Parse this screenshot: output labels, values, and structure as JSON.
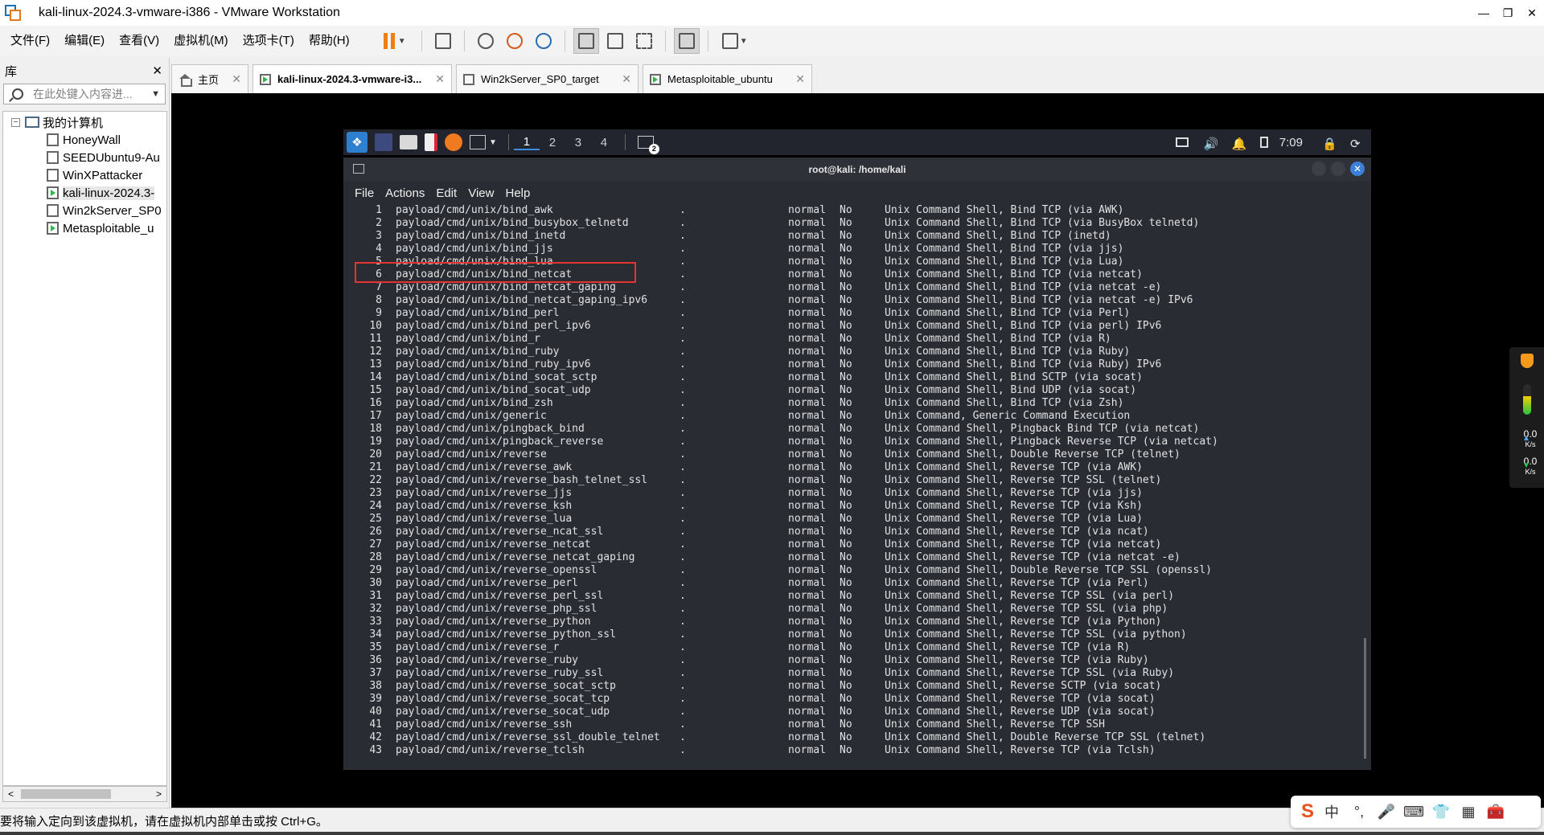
{
  "window": {
    "title": "kali-linux-2024.3-vmware-i386 - VMware Workstation"
  },
  "menu": [
    "文件(F)",
    "编辑(E)",
    "查看(V)",
    "虚拟机(M)",
    "选项卡(T)",
    "帮助(H)"
  ],
  "library": {
    "title": "库",
    "search_placeholder": "在此处键入内容进...",
    "root": "我的计算机",
    "items": [
      {
        "label": "HoneyWall",
        "running": false
      },
      {
        "label": "SEEDUbuntu9-Au",
        "running": false
      },
      {
        "label": "WinXPattacker",
        "running": false
      },
      {
        "label": "kali-linux-2024.3-",
        "running": true,
        "selected": true
      },
      {
        "label": "Win2kServer_SP0",
        "running": false
      },
      {
        "label": "Metasploitable_u",
        "running": true
      }
    ]
  },
  "tabs": [
    {
      "label": "主页",
      "active": false
    },
    {
      "label": "kali-linux-2024.3-vmware-i3...",
      "active": true
    },
    {
      "label": "Win2kServer_SP0_target",
      "active": false
    },
    {
      "label": "Metasploitable_ubuntu",
      "active": false
    }
  ],
  "kali_panel": {
    "workspaces": [
      "1",
      "2",
      "3",
      "4"
    ],
    "active_workspace": "1",
    "clock": "7:09",
    "terminal_badge": "2"
  },
  "terminal": {
    "title": "root@kali: /home/kali",
    "menu": [
      "File",
      "Actions",
      "Edit",
      "View",
      "Help"
    ],
    "rows": [
      {
        "num": "1",
        "name": "payload/cmd/unix/bind_awk",
        "date": ".",
        "rank": "normal",
        "check": "No",
        "desc": "Unix Command Shell, Bind TCP (via AWK)"
      },
      {
        "num": "2",
        "name": "payload/cmd/unix/bind_busybox_telnetd",
        "date": ".",
        "rank": "normal",
        "check": "No",
        "desc": "Unix Command Shell, Bind TCP (via BusyBox telnetd)"
      },
      {
        "num": "3",
        "name": "payload/cmd/unix/bind_inetd",
        "date": ".",
        "rank": "normal",
        "check": "No",
        "desc": "Unix Command Shell, Bind TCP (inetd)"
      },
      {
        "num": "4",
        "name": "payload/cmd/unix/bind_jjs",
        "date": ".",
        "rank": "normal",
        "check": "No",
        "desc": "Unix Command Shell, Bind TCP (via jjs)"
      },
      {
        "num": "5",
        "name": "payload/cmd/unix/bind_lua",
        "date": ".",
        "rank": "normal",
        "check": "No",
        "desc": "Unix Command Shell, Bind TCP (via Lua)"
      },
      {
        "num": "6",
        "name": "payload/cmd/unix/bind_netcat",
        "date": ".",
        "rank": "normal",
        "check": "No",
        "desc": "Unix Command Shell, Bind TCP (via netcat)"
      },
      {
        "num": "7",
        "name": "payload/cmd/unix/bind_netcat_gaping",
        "date": ".",
        "rank": "normal",
        "check": "No",
        "desc": "Unix Command Shell, Bind TCP (via netcat -e)"
      },
      {
        "num": "8",
        "name": "payload/cmd/unix/bind_netcat_gaping_ipv6",
        "date": ".",
        "rank": "normal",
        "check": "No",
        "desc": "Unix Command Shell, Bind TCP (via netcat -e) IPv6"
      },
      {
        "num": "9",
        "name": "payload/cmd/unix/bind_perl",
        "date": ".",
        "rank": "normal",
        "check": "No",
        "desc": "Unix Command Shell, Bind TCP (via Perl)"
      },
      {
        "num": "10",
        "name": "payload/cmd/unix/bind_perl_ipv6",
        "date": ".",
        "rank": "normal",
        "check": "No",
        "desc": "Unix Command Shell, Bind TCP (via perl) IPv6"
      },
      {
        "num": "11",
        "name": "payload/cmd/unix/bind_r",
        "date": ".",
        "rank": "normal",
        "check": "No",
        "desc": "Unix Command Shell, Bind TCP (via R)"
      },
      {
        "num": "12",
        "name": "payload/cmd/unix/bind_ruby",
        "date": ".",
        "rank": "normal",
        "check": "No",
        "desc": "Unix Command Shell, Bind TCP (via Ruby)"
      },
      {
        "num": "13",
        "name": "payload/cmd/unix/bind_ruby_ipv6",
        "date": ".",
        "rank": "normal",
        "check": "No",
        "desc": "Unix Command Shell, Bind TCP (via Ruby) IPv6"
      },
      {
        "num": "14",
        "name": "payload/cmd/unix/bind_socat_sctp",
        "date": ".",
        "rank": "normal",
        "check": "No",
        "desc": "Unix Command Shell, Bind SCTP (via socat)"
      },
      {
        "num": "15",
        "name": "payload/cmd/unix/bind_socat_udp",
        "date": ".",
        "rank": "normal",
        "check": "No",
        "desc": "Unix Command Shell, Bind UDP (via socat)"
      },
      {
        "num": "16",
        "name": "payload/cmd/unix/bind_zsh",
        "date": ".",
        "rank": "normal",
        "check": "No",
        "desc": "Unix Command Shell, Bind TCP (via Zsh)"
      },
      {
        "num": "17",
        "name": "payload/cmd/unix/generic",
        "date": ".",
        "rank": "normal",
        "check": "No",
        "desc": "Unix Command, Generic Command Execution"
      },
      {
        "num": "18",
        "name": "payload/cmd/unix/pingback_bind",
        "date": ".",
        "rank": "normal",
        "check": "No",
        "desc": "Unix Command Shell, Pingback Bind TCP (via netcat)"
      },
      {
        "num": "19",
        "name": "payload/cmd/unix/pingback_reverse",
        "date": ".",
        "rank": "normal",
        "check": "No",
        "desc": "Unix Command Shell, Pingback Reverse TCP (via netcat)"
      },
      {
        "num": "20",
        "name": "payload/cmd/unix/reverse",
        "date": ".",
        "rank": "normal",
        "check": "No",
        "desc": "Unix Command Shell, Double Reverse TCP (telnet)"
      },
      {
        "num": "21",
        "name": "payload/cmd/unix/reverse_awk",
        "date": ".",
        "rank": "normal",
        "check": "No",
        "desc": "Unix Command Shell, Reverse TCP (via AWK)"
      },
      {
        "num": "22",
        "name": "payload/cmd/unix/reverse_bash_telnet_ssl",
        "date": ".",
        "rank": "normal",
        "check": "No",
        "desc": "Unix Command Shell, Reverse TCP SSL (telnet)"
      },
      {
        "num": "23",
        "name": "payload/cmd/unix/reverse_jjs",
        "date": ".",
        "rank": "normal",
        "check": "No",
        "desc": "Unix Command Shell, Reverse TCP (via jjs)"
      },
      {
        "num": "24",
        "name": "payload/cmd/unix/reverse_ksh",
        "date": ".",
        "rank": "normal",
        "check": "No",
        "desc": "Unix Command Shell, Reverse TCP (via Ksh)"
      },
      {
        "num": "25",
        "name": "payload/cmd/unix/reverse_lua",
        "date": ".",
        "rank": "normal",
        "check": "No",
        "desc": "Unix Command Shell, Reverse TCP (via Lua)"
      },
      {
        "num": "26",
        "name": "payload/cmd/unix/reverse_ncat_ssl",
        "date": ".",
        "rank": "normal",
        "check": "No",
        "desc": "Unix Command Shell, Reverse TCP (via ncat)"
      },
      {
        "num": "27",
        "name": "payload/cmd/unix/reverse_netcat",
        "date": ".",
        "rank": "normal",
        "check": "No",
        "desc": "Unix Command Shell, Reverse TCP (via netcat)"
      },
      {
        "num": "28",
        "name": "payload/cmd/unix/reverse_netcat_gaping",
        "date": ".",
        "rank": "normal",
        "check": "No",
        "desc": "Unix Command Shell, Reverse TCP (via netcat -e)"
      },
      {
        "num": "29",
        "name": "payload/cmd/unix/reverse_openssl",
        "date": ".",
        "rank": "normal",
        "check": "No",
        "desc": "Unix Command Shell, Double Reverse TCP SSL (openssl)"
      },
      {
        "num": "30",
        "name": "payload/cmd/unix/reverse_perl",
        "date": ".",
        "rank": "normal",
        "check": "No",
        "desc": "Unix Command Shell, Reverse TCP (via Perl)"
      },
      {
        "num": "31",
        "name": "payload/cmd/unix/reverse_perl_ssl",
        "date": ".",
        "rank": "normal",
        "check": "No",
        "desc": "Unix Command Shell, Reverse TCP SSL (via perl)"
      },
      {
        "num": "32",
        "name": "payload/cmd/unix/reverse_php_ssl",
        "date": ".",
        "rank": "normal",
        "check": "No",
        "desc": "Unix Command Shell, Reverse TCP SSL (via php)"
      },
      {
        "num": "33",
        "name": "payload/cmd/unix/reverse_python",
        "date": ".",
        "rank": "normal",
        "check": "No",
        "desc": "Unix Command Shell, Reverse TCP (via Python)"
      },
      {
        "num": "34",
        "name": "payload/cmd/unix/reverse_python_ssl",
        "date": ".",
        "rank": "normal",
        "check": "No",
        "desc": "Unix Command Shell, Reverse TCP SSL (via python)"
      },
      {
        "num": "35",
        "name": "payload/cmd/unix/reverse_r",
        "date": ".",
        "rank": "normal",
        "check": "No",
        "desc": "Unix Command Shell, Reverse TCP (via R)"
      },
      {
        "num": "36",
        "name": "payload/cmd/unix/reverse_ruby",
        "date": ".",
        "rank": "normal",
        "check": "No",
        "desc": "Unix Command Shell, Reverse TCP (via Ruby)"
      },
      {
        "num": "37",
        "name": "payload/cmd/unix/reverse_ruby_ssl",
        "date": ".",
        "rank": "normal",
        "check": "No",
        "desc": "Unix Command Shell, Reverse TCP SSL (via Ruby)"
      },
      {
        "num": "38",
        "name": "payload/cmd/unix/reverse_socat_sctp",
        "date": ".",
        "rank": "normal",
        "check": "No",
        "desc": "Unix Command Shell, Reverse SCTP (via socat)"
      },
      {
        "num": "39",
        "name": "payload/cmd/unix/reverse_socat_tcp",
        "date": ".",
        "rank": "normal",
        "check": "No",
        "desc": "Unix Command Shell, Reverse TCP (via socat)"
      },
      {
        "num": "40",
        "name": "payload/cmd/unix/reverse_socat_udp",
        "date": ".",
        "rank": "normal",
        "check": "No",
        "desc": "Unix Command Shell, Reverse UDP (via socat)"
      },
      {
        "num": "41",
        "name": "payload/cmd/unix/reverse_ssh",
        "date": ".",
        "rank": "normal",
        "check": "No",
        "desc": "Unix Command Shell, Reverse TCP SSH"
      },
      {
        "num": "42",
        "name": "payload/cmd/unix/reverse_ssl_double_telnet",
        "date": ".",
        "rank": "normal",
        "check": "No",
        "desc": "Unix Command Shell, Double Reverse TCP SSL (telnet)"
      },
      {
        "num": "43",
        "name": "payload/cmd/unix/reverse_tclsh",
        "date": ".",
        "rank": "normal",
        "check": "No",
        "desc": "Unix Command Shell, Reverse TCP (via Tclsh)"
      }
    ],
    "highlighted_row": "6"
  },
  "side_widget": {
    "up_value": "0.0",
    "up_unit": "K/s",
    "down_value": "0.0",
    "down_unit": "K/s"
  },
  "status": {
    "message": "要将输入定向到该虚拟机，请在虚拟机内部单击或按 Ctrl+G。"
  },
  "ime": {
    "items": [
      "中",
      "°,",
      "mic-icon",
      "keyboard-icon",
      "skin-icon",
      "grid-icon",
      "tools-icon"
    ]
  },
  "colors": {
    "highlight_box": "#e3342f",
    "kali_accent": "#3a7fd8",
    "pause_orange": "#f07d12",
    "terminal_bg": "#2a2c34"
  }
}
